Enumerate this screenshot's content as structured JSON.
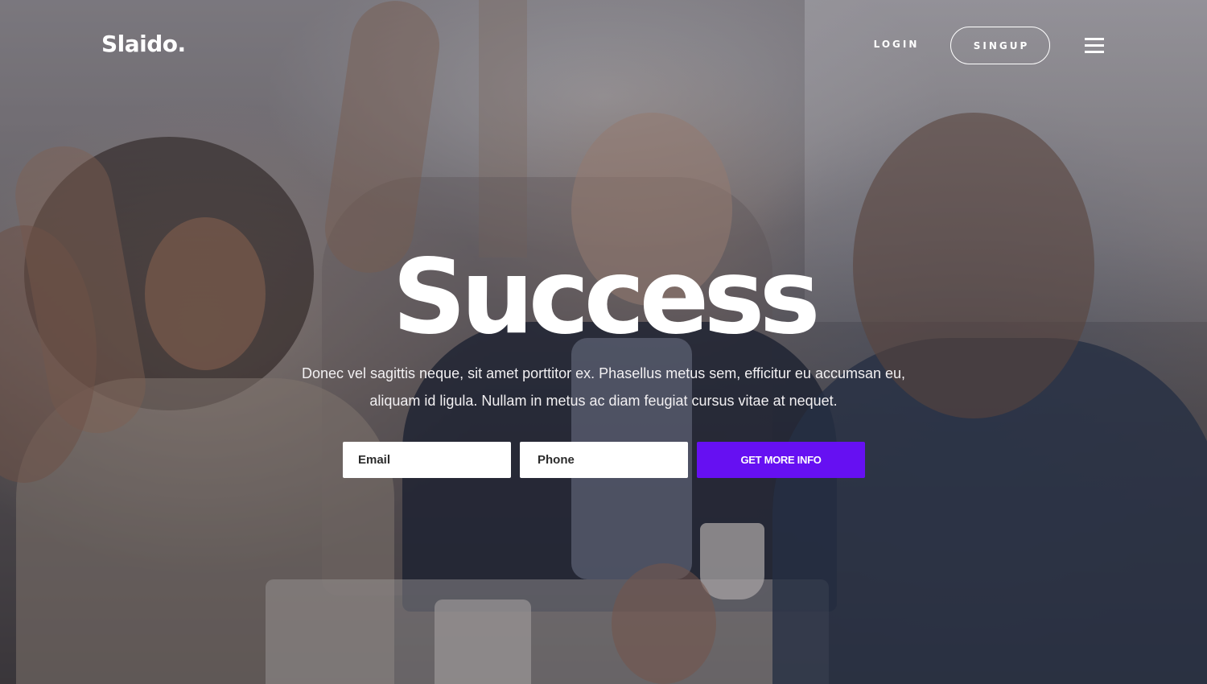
{
  "header": {
    "logo": "Slaido.",
    "login_label": "LOGIN",
    "signup_label": "SINGUP",
    "menu_icon": "hamburger-menu-icon"
  },
  "hero": {
    "title": "Success",
    "description": "Donec vel sagittis neque, sit amet porttitor ex. Phasellus metus sem, efficitur eu accumsan eu, aliquam id ligula. Nullam in metus ac diam feugiat cursus vitae at nequet.",
    "form": {
      "email_placeholder": "Email",
      "phone_placeholder": "Phone",
      "submit_label": "GET MORE INFO"
    }
  },
  "colors": {
    "accent": "#6610f2",
    "text": "#ffffff",
    "overlay": "#19161e"
  }
}
